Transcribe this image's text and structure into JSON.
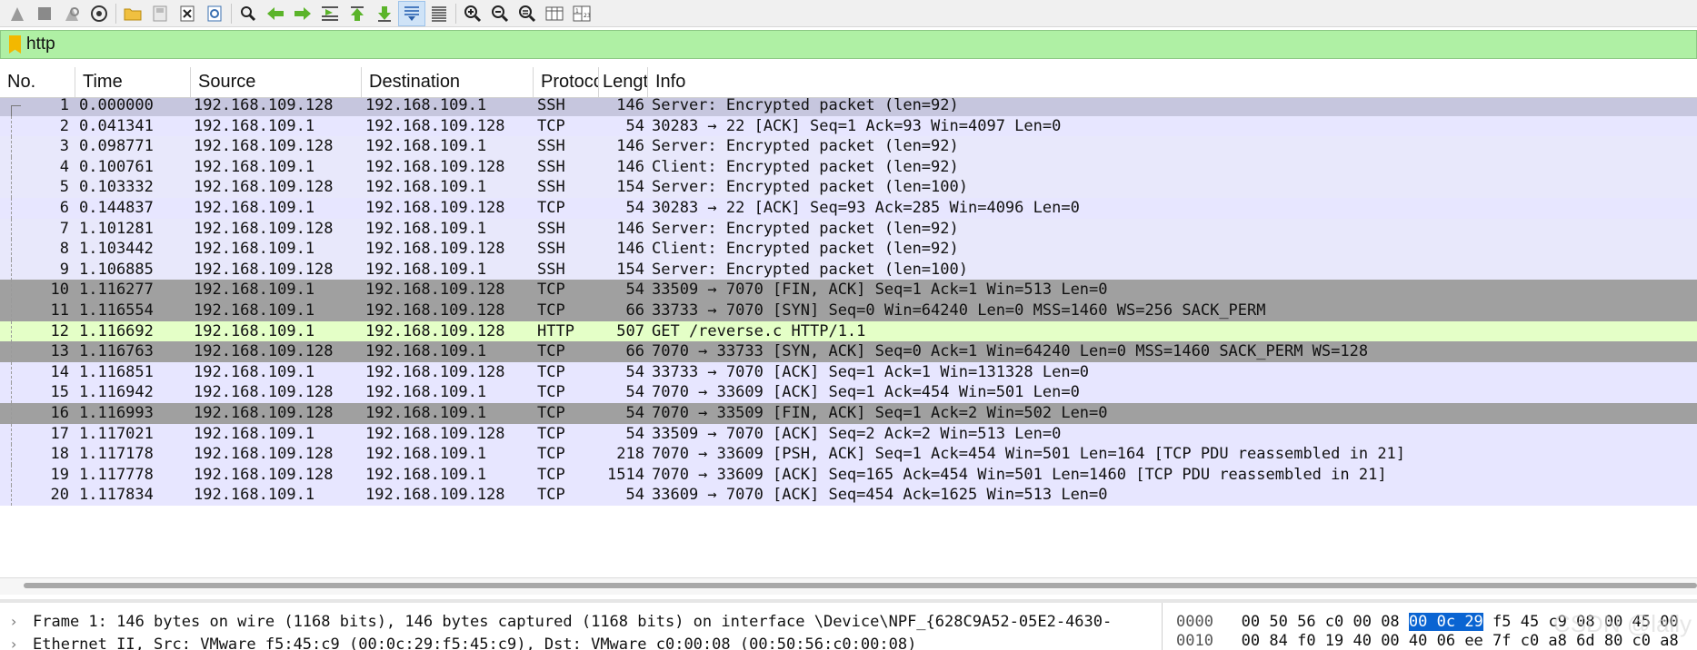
{
  "toolbar": {
    "buttons": [
      {
        "name": "start-capture-icon"
      },
      {
        "name": "stop-capture-icon"
      },
      {
        "name": "restart-capture-icon"
      },
      {
        "name": "capture-options-icon"
      },
      {
        "sep": true
      },
      {
        "name": "open-file-icon"
      },
      {
        "name": "save-file-icon"
      },
      {
        "name": "close-file-icon"
      },
      {
        "name": "reload-file-icon"
      },
      {
        "sep": true
      },
      {
        "name": "find-packet-icon"
      },
      {
        "name": "go-back-icon"
      },
      {
        "name": "go-forward-icon"
      },
      {
        "name": "go-to-packet-icon"
      },
      {
        "name": "go-first-packet-icon"
      },
      {
        "name": "go-last-packet-icon"
      },
      {
        "name": "autoscroll-icon",
        "selected": true
      },
      {
        "name": "colorize-icon"
      },
      {
        "sep": true
      },
      {
        "name": "zoom-in-icon"
      },
      {
        "name": "zoom-out-icon"
      },
      {
        "name": "zoom-normal-icon"
      },
      {
        "name": "resize-columns-icon"
      },
      {
        "name": "layout-panes-icon"
      }
    ]
  },
  "filter": {
    "value": "http"
  },
  "columns": [
    "No.",
    "Time",
    "Source",
    "Destination",
    "Protoco",
    "Lengt",
    "Info"
  ],
  "colors": {
    "ssh": "#e8e8fb",
    "ssh_selected": "#c6c6de",
    "tcp": "#e7e6ff",
    "tcp_dark": "#a0a0a0",
    "http": "#e4ffc7",
    "filter_bg": "#aff0a4",
    "hex_highlight": "#0a64d2"
  },
  "packets": [
    {
      "no": "1",
      "time": "0.000000",
      "src": "192.168.109.128",
      "dst": "192.168.109.1",
      "proto": "SSH",
      "len": "146",
      "info": "Server: Encrypted packet (len=92)",
      "style": "sel"
    },
    {
      "no": "2",
      "time": "0.041341",
      "src": "192.168.109.1",
      "dst": "192.168.109.128",
      "proto": "TCP",
      "len": "54",
      "info": "30283 → 22 [ACK] Seq=1 Ack=93 Win=4097 Len=0",
      "style": "tcp"
    },
    {
      "no": "3",
      "time": "0.098771",
      "src": "192.168.109.128",
      "dst": "192.168.109.1",
      "proto": "SSH",
      "len": "146",
      "info": "Server: Encrypted packet (len=92)",
      "style": "ssh"
    },
    {
      "no": "4",
      "time": "0.100761",
      "src": "192.168.109.1",
      "dst": "192.168.109.128",
      "proto": "SSH",
      "len": "146",
      "info": "Client: Encrypted packet (len=92)",
      "style": "ssh"
    },
    {
      "no": "5",
      "time": "0.103332",
      "src": "192.168.109.128",
      "dst": "192.168.109.1",
      "proto": "SSH",
      "len": "154",
      "info": "Server: Encrypted packet (len=100)",
      "style": "ssh"
    },
    {
      "no": "6",
      "time": "0.144837",
      "src": "192.168.109.1",
      "dst": "192.168.109.128",
      "proto": "TCP",
      "len": "54",
      "info": "30283 → 22 [ACK] Seq=93 Ack=285 Win=4096 Len=0",
      "style": "tcp"
    },
    {
      "no": "7",
      "time": "1.101281",
      "src": "192.168.109.128",
      "dst": "192.168.109.1",
      "proto": "SSH",
      "len": "146",
      "info": "Server: Encrypted packet (len=92)",
      "style": "ssh"
    },
    {
      "no": "8",
      "time": "1.103442",
      "src": "192.168.109.1",
      "dst": "192.168.109.128",
      "proto": "SSH",
      "len": "146",
      "info": "Client: Encrypted packet (len=92)",
      "style": "ssh"
    },
    {
      "no": "9",
      "time": "1.106885",
      "src": "192.168.109.128",
      "dst": "192.168.109.1",
      "proto": "SSH",
      "len": "154",
      "info": "Server: Encrypted packet (len=100)",
      "style": "ssh"
    },
    {
      "no": "10",
      "time": "1.116277",
      "src": "192.168.109.1",
      "dst": "192.168.109.128",
      "proto": "TCP",
      "len": "54",
      "info": "33509 → 7070 [FIN, ACK] Seq=1 Ack=1 Win=513 Len=0",
      "style": "dark"
    },
    {
      "no": "11",
      "time": "1.116554",
      "src": "192.168.109.1",
      "dst": "192.168.109.128",
      "proto": "TCP",
      "len": "66",
      "info": "33733 → 7070 [SYN] Seq=0 Win=64240 Len=0 MSS=1460 WS=256 SACK_PERM",
      "style": "dark"
    },
    {
      "no": "12",
      "time": "1.116692",
      "src": "192.168.109.1",
      "dst": "192.168.109.128",
      "proto": "HTTP",
      "len": "507",
      "info": "GET /reverse.c HTTP/1.1",
      "style": "http"
    },
    {
      "no": "13",
      "time": "1.116763",
      "src": "192.168.109.128",
      "dst": "192.168.109.1",
      "proto": "TCP",
      "len": "66",
      "info": "7070 → 33733 [SYN, ACK] Seq=0 Ack=1 Win=64240 Len=0 MSS=1460 SACK_PERM WS=128",
      "style": "dark"
    },
    {
      "no": "14",
      "time": "1.116851",
      "src": "192.168.109.1",
      "dst": "192.168.109.128",
      "proto": "TCP",
      "len": "54",
      "info": "33733 → 7070 [ACK] Seq=1 Ack=1 Win=131328 Len=0",
      "style": "tcp"
    },
    {
      "no": "15",
      "time": "1.116942",
      "src": "192.168.109.128",
      "dst": "192.168.109.1",
      "proto": "TCP",
      "len": "54",
      "info": "7070 → 33609 [ACK] Seq=1 Ack=454 Win=501 Len=0",
      "style": "tcp"
    },
    {
      "no": "16",
      "time": "1.116993",
      "src": "192.168.109.128",
      "dst": "192.168.109.1",
      "proto": "TCP",
      "len": "54",
      "info": "7070 → 33509 [FIN, ACK] Seq=1 Ack=2 Win=502 Len=0",
      "style": "dark"
    },
    {
      "no": "17",
      "time": "1.117021",
      "src": "192.168.109.1",
      "dst": "192.168.109.128",
      "proto": "TCP",
      "len": "54",
      "info": "33509 → 7070 [ACK] Seq=2 Ack=2 Win=513 Len=0",
      "style": "tcp"
    },
    {
      "no": "18",
      "time": "1.117178",
      "src": "192.168.109.128",
      "dst": "192.168.109.1",
      "proto": "TCP",
      "len": "218",
      "info": "7070 → 33609 [PSH, ACK] Seq=1 Ack=454 Win=501 Len=164 [TCP PDU reassembled in 21]",
      "style": "tcp"
    },
    {
      "no": "19",
      "time": "1.117778",
      "src": "192.168.109.128",
      "dst": "192.168.109.1",
      "proto": "TCP",
      "len": "1514",
      "info": "7070 → 33609 [ACK] Seq=165 Ack=454 Win=501 Len=1460 [TCP PDU reassembled in 21]",
      "style": "tcp"
    },
    {
      "no": "20",
      "time": "1.117834",
      "src": "192.168.109.1",
      "dst": "192.168.109.128",
      "proto": "TCP",
      "len": "54",
      "info": "33609 → 7070 [ACK] Seq=454 Ack=1625 Win=513 Len=0",
      "style": "tcp"
    }
  ],
  "details": [
    "Frame 1: 146 bytes on wire (1168 bits), 146 bytes captured (1168 bits) on interface \\Device\\NPF_{628C9A52-05E2-4630-",
    "Ethernet II, Src: VMware_f5:45:c9 (00:0c:29:f5:45:c9), Dst: VMware_c0:00:08 (00:50:56:c0:00:08)"
  ],
  "hex": [
    {
      "offset": "0000",
      "pre": "00 50 56 c0 00 08 ",
      "hl": "00 0c  29",
      "post": " f5 45 c9 08 00 45 00"
    },
    {
      "offset": "0010",
      "pre": "00 84 f0 19 40 00 40 06  ",
      "hl": "",
      "post": "ee 7f c0 a8 6d 80 c0 a8"
    }
  ],
  "watermark": "CSDN @lally"
}
